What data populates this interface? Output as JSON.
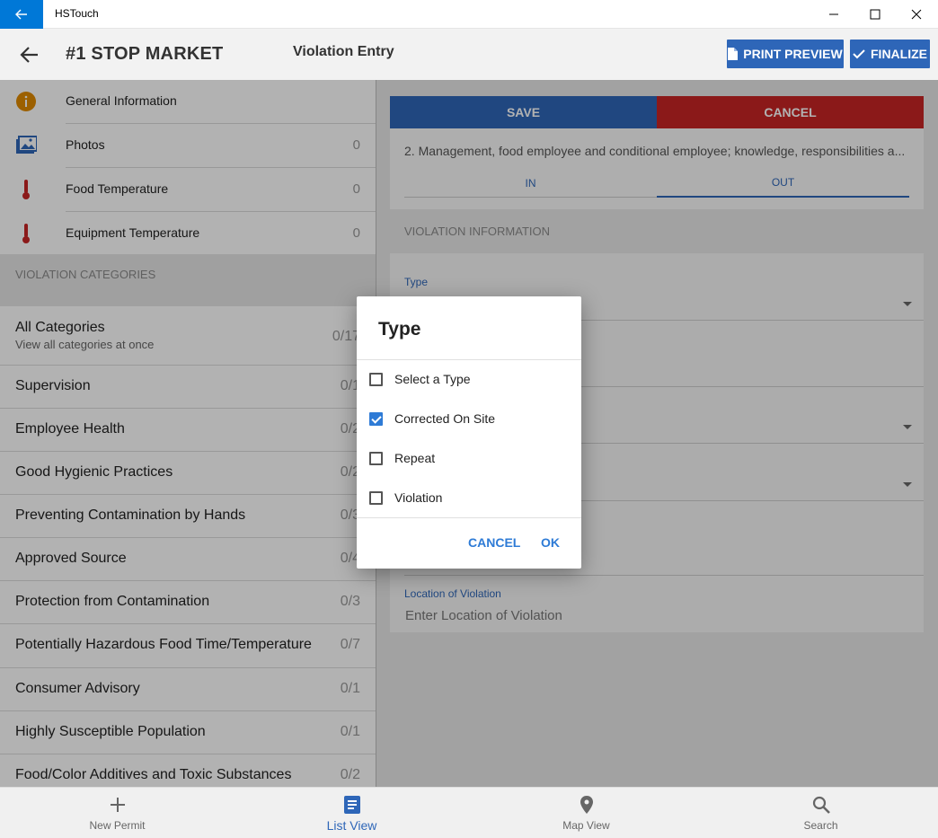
{
  "window": {
    "app_title": "HSTouch"
  },
  "header": {
    "store_name": "#1 STOP MARKET",
    "page_title": "Violation Entry",
    "print_preview_label": "PRINT PREVIEW",
    "finalize_label": "FINALIZE"
  },
  "info_items": [
    {
      "label": "General Information",
      "count": "",
      "icon": "info-icon"
    },
    {
      "label": "Photos",
      "count": "0",
      "icon": "photos-icon"
    },
    {
      "label": "Food Temperature",
      "count": "0",
      "icon": "thermometer-icon"
    },
    {
      "label": "Equipment Temperature",
      "count": "0",
      "icon": "thermometer-icon"
    }
  ],
  "categories_header": "VIOLATION CATEGORIES",
  "categories": [
    {
      "name": "All Categories",
      "sub": "View all categories at once",
      "count": "0/17"
    },
    {
      "name": "Supervision",
      "count": "0/1"
    },
    {
      "name": "Employee Health",
      "count": "0/2"
    },
    {
      "name": "Good Hygienic Practices",
      "count": "0/2"
    },
    {
      "name": "Preventing Contamination by Hands",
      "count": "0/3"
    },
    {
      "name": "Approved Source",
      "count": "0/4"
    },
    {
      "name": "Protection from Contamination",
      "count": "0/3"
    },
    {
      "name": "Potentially Hazardous Food Time/Temperature",
      "count": "0/7"
    },
    {
      "name": "Consumer Advisory",
      "count": "0/1"
    },
    {
      "name": "Highly Susceptible Population",
      "count": "0/1"
    },
    {
      "name": "Food/Color Additives and Toxic Substances",
      "count": "0/2"
    }
  ],
  "editor": {
    "save_label": "SAVE",
    "cancel_label": "CANCEL",
    "item_text": "2. Management, food employee and conditional employee; knowledge, responsibilities a...",
    "tab_in": "IN",
    "tab_out": "OUT",
    "section_label": "VIOLATION INFORMATION",
    "type_label": "Type",
    "location_label": "Location of Violation",
    "location_placeholder": "Enter Location of Violation"
  },
  "dialog": {
    "title": "Type",
    "options": [
      {
        "label": "Select a Type",
        "checked": false
      },
      {
        "label": "Corrected On Site",
        "checked": true
      },
      {
        "label": "Repeat",
        "checked": false
      },
      {
        "label": "Violation",
        "checked": false
      }
    ],
    "cancel_label": "CANCEL",
    "ok_label": "OK"
  },
  "bottom_nav": [
    {
      "label": "New Permit",
      "icon": "plus-icon"
    },
    {
      "label": "List View",
      "icon": "list-icon",
      "active": true
    },
    {
      "label": "Map View",
      "icon": "map-pin-icon"
    },
    {
      "label": "Search",
      "icon": "search-icon"
    }
  ],
  "colors": {
    "accent": "#2e66b8",
    "danger": "#c72424",
    "titlebar_accent": "#0078d7",
    "checkbox": "#2e7bd6"
  }
}
